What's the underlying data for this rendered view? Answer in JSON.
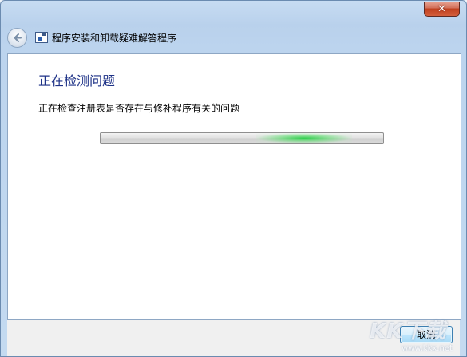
{
  "window": {
    "title": "程序安装和卸载疑难解答程序",
    "close_glyph": "✕"
  },
  "main": {
    "heading": "正在检测问题",
    "status": "正在检查注册表是否存在与修补程序有关的问题",
    "progress": {
      "mode": "indeterminate",
      "glow_position_fraction": 0.72,
      "accent_color": "#2ecc40"
    }
  },
  "footer": {
    "cancel_label": "取消"
  },
  "icons": {
    "back": "back-arrow-icon",
    "app": "troubleshooter-app-icon",
    "close": "close-icon"
  },
  "watermark": {
    "logo_text": "KK下载",
    "url": "www.kkx.net"
  }
}
